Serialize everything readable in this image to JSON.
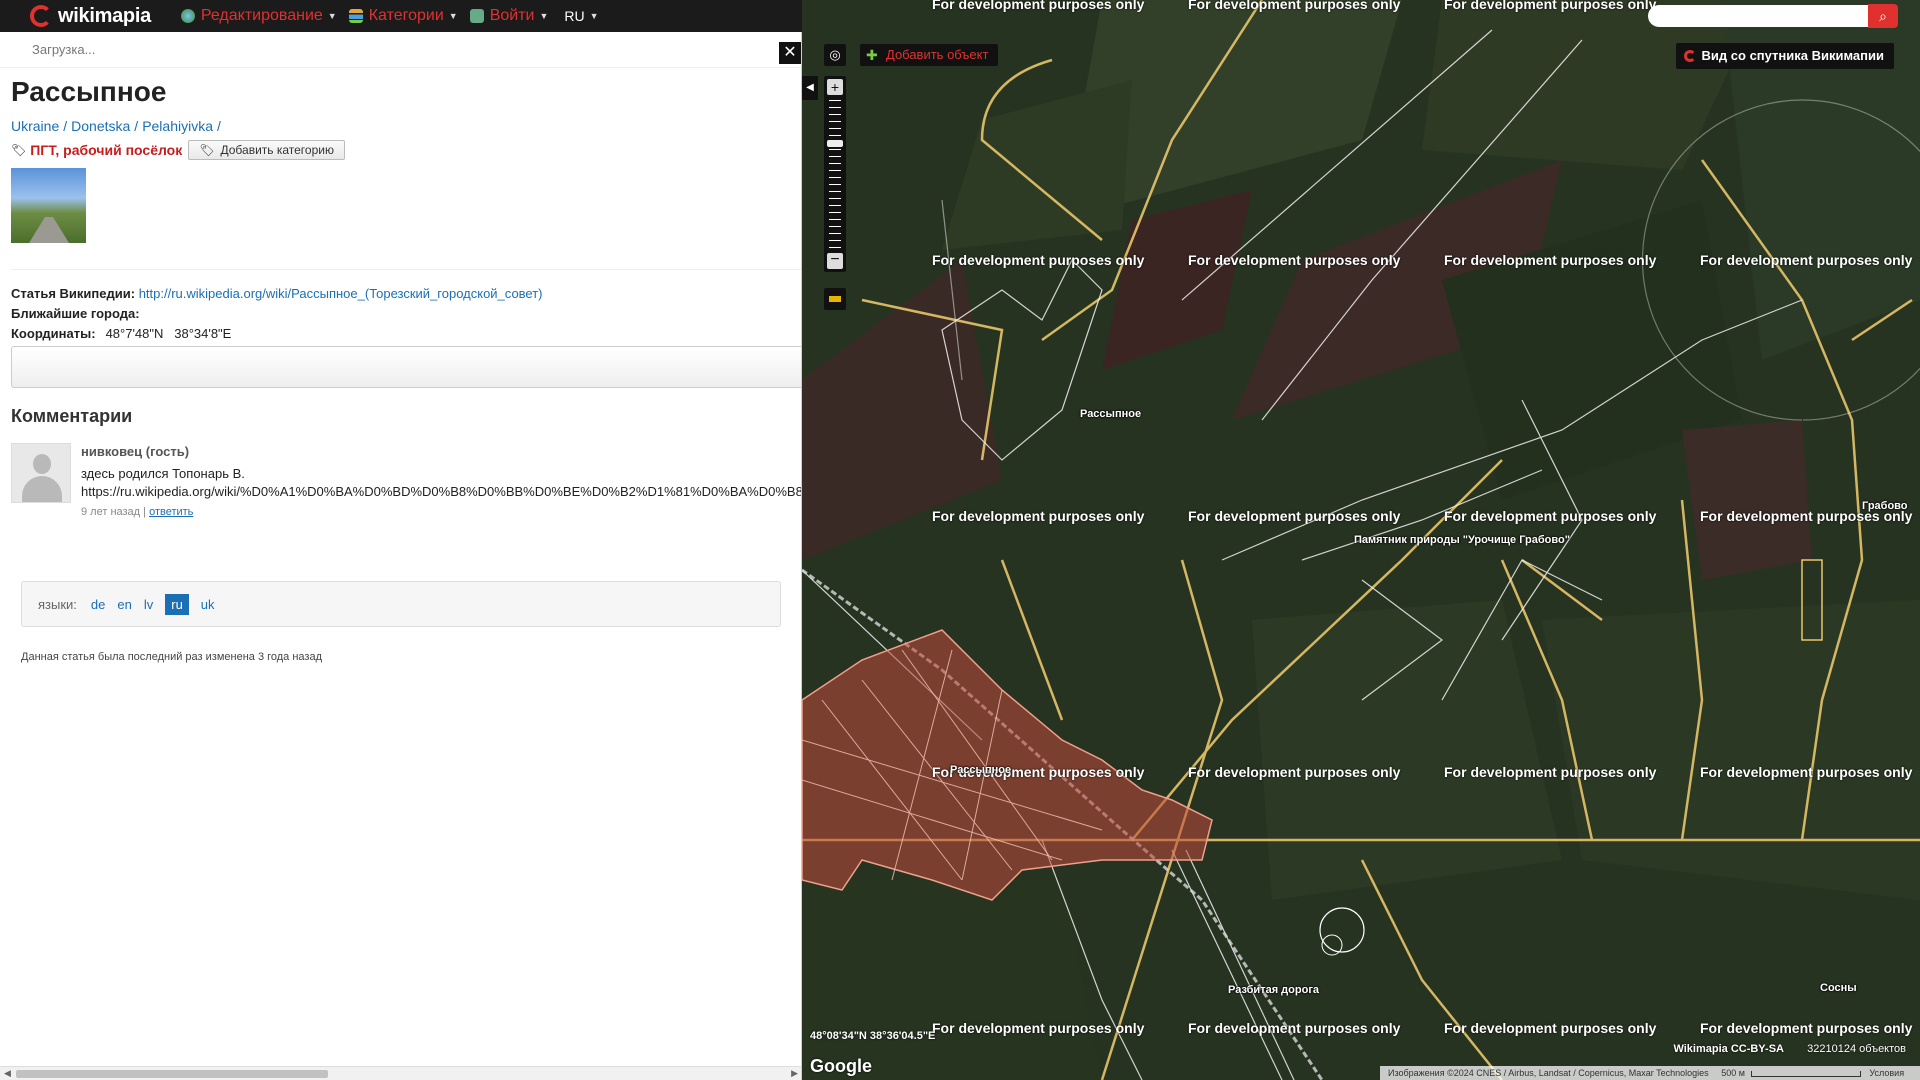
{
  "topbar": {
    "logo": "wikimapia",
    "menu": [
      {
        "label": "Редактирование",
        "icon": "globe-icon"
      },
      {
        "label": "Категории",
        "icon": "categories-icon"
      },
      {
        "label": "Войти",
        "icon": "login-icon"
      }
    ],
    "lang": "RU"
  },
  "panel": {
    "loading": "Загрузка...",
    "title": "Рассыпное",
    "breadcrumb": [
      "Ukraine",
      "Donetska",
      "Pelahiyivka"
    ],
    "category": "ПГТ, рабочий посёлок",
    "add_category": "Добавить категорию",
    "wiki_label": "Статья Википедии:",
    "wiki_url": "http://ru.wikipedia.org/wiki/Рассыпное_(Торезский_городской_совет)",
    "nearest_label": "Ближайшие города:",
    "coords_label": "Координаты:",
    "coords_value": "48°7'48\"N   38°34'8\"E",
    "comments_heading": "Комментарии",
    "comment": {
      "author": "нивковец (гость)",
      "text": "здесь родился Топонарь В.",
      "link": "https://ru.wikipedia.org/wiki/%D0%A1%D0%BA%D0%BD%D0%B8%D0%BB%D0%BE%D0%B2%D1%81%D0%BA%D0%B8",
      "time": "9 лет назад",
      "separator": "|",
      "reply": "ответить"
    },
    "languages_label": "языки:",
    "languages": [
      "de",
      "en",
      "lv",
      "ru",
      "uk"
    ],
    "active_language": "ru",
    "updated": "Данная статья была последний раз изменена 3 года назад"
  },
  "map": {
    "add_object": "Добавить объект",
    "satellite_button": "Вид со спутника Викимапии",
    "watermark": "For development purposes only",
    "labels": {
      "rassypnoe_north": "Рассыпное",
      "rassypnoe_town": "Рассыпное",
      "monument": "Памятник природы \"Урочище Грабово\"",
      "grabovo": "Грабово",
      "broken_road": "Разбитая дорога",
      "sosny": "Сосны"
    },
    "coords_readout": "48°08'34\"N 38°36'04.5\"E",
    "google": "Google",
    "license": "Wikimapia CC-BY-SA",
    "objects_count": "32210124 объектов",
    "attribution": "Изображения ©2024 CNES / Airbus, Landsat / Copernicus, Maxar Technologies",
    "scale": "500 м",
    "terms": "Условия",
    "colors": {
      "roads": "#e8c56a",
      "town_fill": "#c0483a",
      "accent": "#e0312f"
    }
  }
}
